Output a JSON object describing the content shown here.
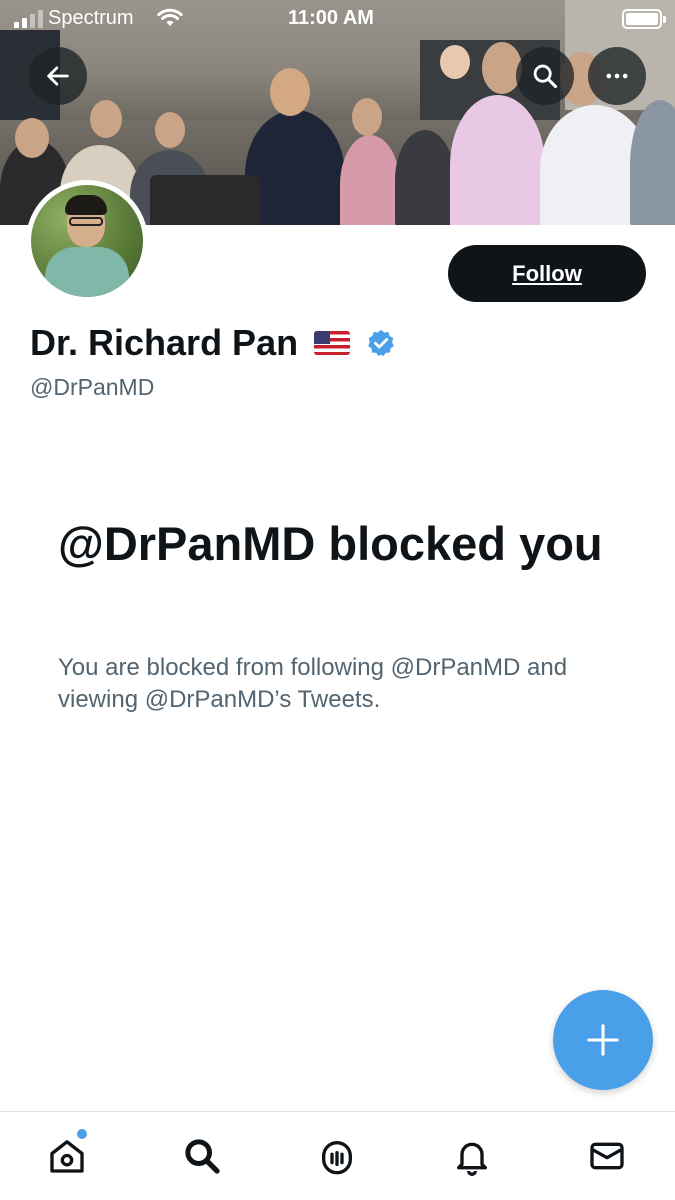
{
  "status_bar": {
    "carrier": "Spectrum",
    "time": "11:00 AM"
  },
  "header": {
    "back_icon": "arrow-left-icon",
    "search_icon": "search-icon",
    "more_icon": "more-horizontal-icon"
  },
  "profile": {
    "display_name": "Dr. Richard Pan",
    "flag_emoji": "us-flag",
    "verified_icon": "verified-badge-icon",
    "handle": "@DrPanMD",
    "follow_label": "Follow"
  },
  "blocked": {
    "title": "@DrPanMD blocked you",
    "description": "You are blocked from following @DrPanMD and viewing @DrPanMD’s Tweets."
  },
  "fab": {
    "icon": "plus-icon"
  },
  "bottom_nav": {
    "items": [
      {
        "icon": "home-icon",
        "has_notification_dot": true
      },
      {
        "icon": "search-icon"
      },
      {
        "icon": "spaces-icon"
      },
      {
        "icon": "bell-icon"
      },
      {
        "icon": "mail-icon"
      }
    ]
  },
  "colors": {
    "accent": "#4a9fe9",
    "text_primary": "#0f1419",
    "text_secondary": "#536471",
    "follow_button": "#0f1419"
  }
}
